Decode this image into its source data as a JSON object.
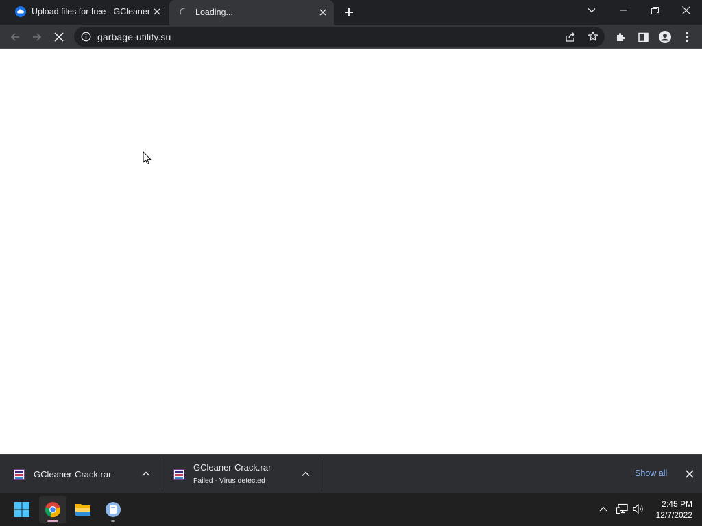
{
  "browser": {
    "tabs": [
      {
        "title": "Upload files for free - GCleaner-Crack.rar - ufile.io",
        "favicon": "ufile-cloud-icon",
        "active": false
      },
      {
        "title": "Loading...",
        "favicon": "loading-spinner-icon",
        "active": true
      }
    ],
    "new_tab_icon": "plus-icon",
    "window_controls": [
      "chevron-down-icon",
      "minimize-icon",
      "restore-icon",
      "close-icon"
    ],
    "address": {
      "url": "garbage-utility.su",
      "security_icon": "info-icon"
    },
    "toolbar_icons": [
      "back-icon",
      "forward-icon",
      "stop-icon",
      "share-icon",
      "star-icon",
      "extensions-icon",
      "side-panel-icon",
      "profile-icon",
      "menu-icon"
    ]
  },
  "downloads": {
    "items": [
      {
        "filename": "GCleaner-Crack.rar",
        "status": ""
      },
      {
        "filename": "GCleaner-Crack.rar",
        "status": "Failed - Virus detected"
      }
    ],
    "show_all": "Show all"
  },
  "taskbar": {
    "apps": [
      "windows-start-icon",
      "chrome-icon",
      "file-explorer-icon",
      "app-icon"
    ],
    "tray_icons": [
      "chevron-up-icon",
      "network-icon",
      "volume-icon"
    ],
    "time": "2:45 PM",
    "date": "12/7/2022"
  },
  "colors": {
    "tab_strip": "#202124",
    "toolbar": "#35363a",
    "shelf": "#2d2e31",
    "taskbar": "#202020",
    "link": "#8ab4f8"
  }
}
